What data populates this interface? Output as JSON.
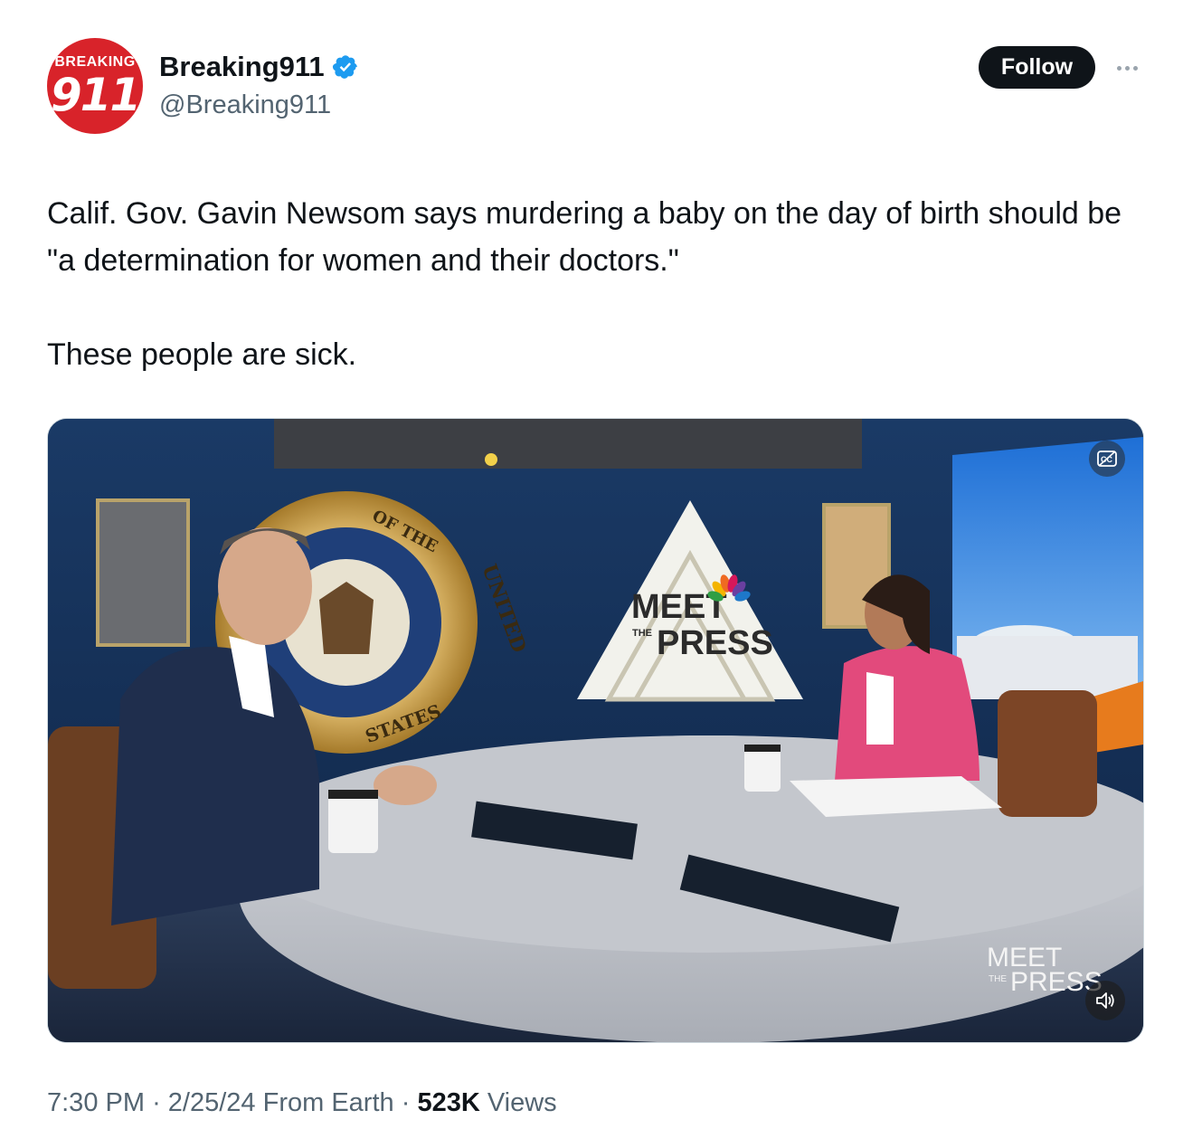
{
  "account": {
    "display_name": "Breaking911",
    "handle": "@Breaking911",
    "verified": true,
    "avatar_icon": "breaking911-logo",
    "avatar_brand_top": "BREAKING",
    "avatar_brand_number": "911",
    "verified_color": "#1d9bf0",
    "avatar_color": "#d8232a"
  },
  "actions": {
    "follow_label": "Follow",
    "more_icon": "more-dots-icon"
  },
  "tweet": {
    "paragraphs": [
      "Calif. Gov. Gavin Newsom says murdering a baby on the day of birth should be \"a determination for women and their doctors.\"",
      "These people are sick."
    ]
  },
  "media": {
    "type": "video",
    "seal_text_top": "OF THE",
    "seal_text_right": "UNITED",
    "seal_text_bottom": "STATES",
    "screen_logo_top": "MEET",
    "screen_logo_the": "THE",
    "screen_logo_bottom": "PRESS",
    "watermark_top": "MEET",
    "watermark_the": "THE",
    "watermark_bottom": "PRESS",
    "captions_icon": "closed-captions-off-icon",
    "sound_icon": "speaker-icon"
  },
  "meta": {
    "time": "7:30 PM",
    "date": "2/25/24",
    "source": "From Earth",
    "views_count": "523K",
    "views_label": "Views",
    "separator": "·"
  }
}
